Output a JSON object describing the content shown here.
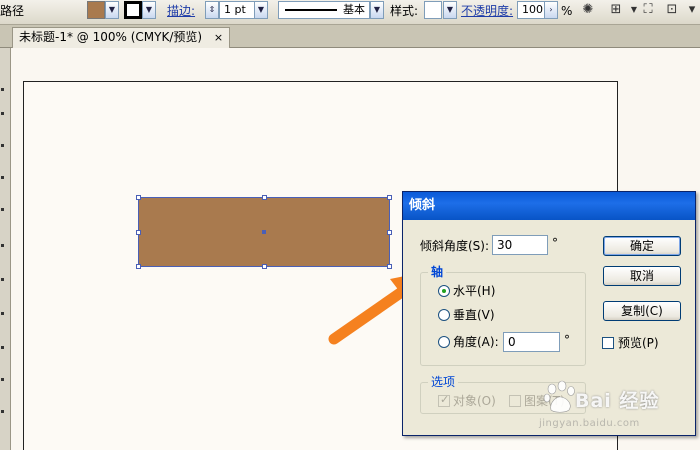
{
  "toolbar": {
    "path_label": "路径",
    "fill_color": "#a97a4e",
    "stroke_color": "#000000",
    "stroke_label": "描边:",
    "stroke_weight": "1 pt",
    "brush_label": "基本",
    "style_label": "样式:",
    "opacity_label": "不透明度:",
    "opacity_value": "100",
    "percent": "%"
  },
  "document": {
    "tab_title": "未标题-1* @ 100% (CMYK/预览)",
    "close": "×"
  },
  "artwork": {
    "fill_color": "#a97a4e",
    "selection_color": "#4a5fb6"
  },
  "dialog": {
    "title": "倾斜",
    "shear_angle_label": "倾斜角度(S):",
    "shear_angle_value": "30",
    "degree": "°",
    "axis_group": "轴",
    "horizontal_label": "水平(H)",
    "vertical_label": "垂直(V)",
    "angle_label": "角度(A):",
    "angle_value": "0",
    "options_group": "选项",
    "objects_label": "对象(O)",
    "patterns_label": "图案(T)",
    "ok_button": "确定",
    "cancel_button": "取消",
    "copy_button": "复制(C)",
    "preview_label": "预览(P)"
  },
  "watermark": {
    "brand": "Bai 经验",
    "url": "jingyan.baidu.com"
  },
  "accent_colors": {
    "title_bar": "#0a5ad8",
    "arrow": "#f5811f",
    "group_title": "#0046d5"
  }
}
